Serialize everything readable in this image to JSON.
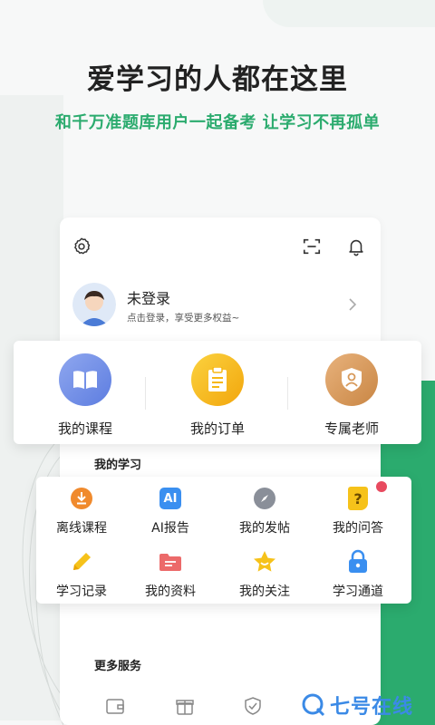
{
  "header": {
    "title": "爱学习的人都在这里",
    "subtitle": "和千万准题库用户一起备考 让学习不再孤单"
  },
  "topbar": {
    "icons": [
      "settings-icon",
      "scan-icon",
      "bell-icon"
    ]
  },
  "profile": {
    "name": "未登录",
    "hint": "点击登录，享受更多权益~"
  },
  "quick": [
    {
      "label": "我的课程",
      "icon": "book-icon",
      "color": "#6f8de8"
    },
    {
      "label": "我的订单",
      "icon": "clipboard-icon",
      "color": "#f6b712"
    },
    {
      "label": "专属老师",
      "icon": "teacher-icon",
      "color": "#d7995a"
    }
  ],
  "study": {
    "title": "我的学习",
    "items": [
      {
        "label": "离线课程",
        "icon": "download-icon",
        "color": "#f08a2d"
      },
      {
        "label": "AI报告",
        "icon": "ai-icon",
        "color": "#3a8ff0",
        "icon_text": "AI"
      },
      {
        "label": "我的发帖",
        "icon": "compass-icon",
        "color": "#8a8f99"
      },
      {
        "label": "我的问答",
        "icon": "question-icon",
        "color": "#f6c21a",
        "icon_text": "?"
      },
      {
        "label": "学习记录",
        "icon": "pencil-icon",
        "color": "#f6c21a"
      },
      {
        "label": "我的资料",
        "icon": "folder-icon",
        "color": "#ec6a6a"
      },
      {
        "label": "我的关注",
        "icon": "star-icon",
        "color": "#f6c21a"
      },
      {
        "label": "学习通道",
        "icon": "lock-icon",
        "color": "#3a8ff0"
      }
    ]
  },
  "more": {
    "title": "更多服务",
    "icons": [
      "wallet-icon",
      "gift-icon",
      "shield-icon"
    ]
  },
  "watermark": {
    "text": "七号在线"
  },
  "colors": {
    "brand_green": "#2bab6e",
    "card_bg": "#ffffff",
    "notification_dot": "#e84a5f"
  }
}
